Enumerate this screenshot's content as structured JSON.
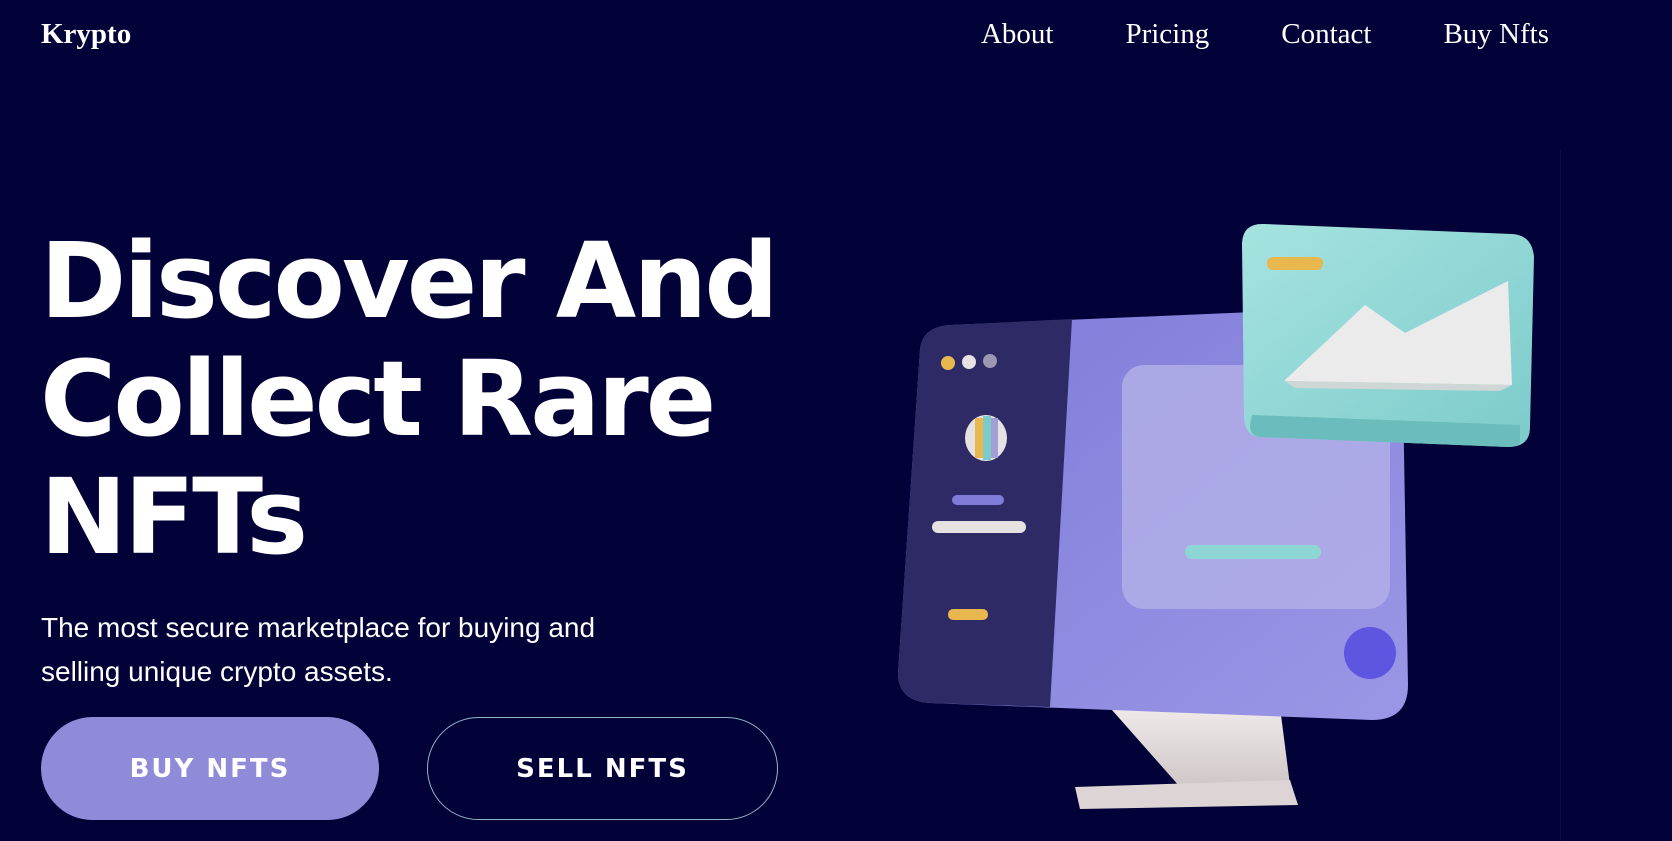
{
  "nav": {
    "logo": "Krypto",
    "links": [
      "About",
      "Pricing",
      "Contact",
      "Buy Nfts"
    ]
  },
  "hero": {
    "title_lines": [
      "Discover And",
      "Collect Rare",
      "NFTs"
    ],
    "subtitle_lines": [
      "The most secure marketplace for buying and",
      "selling unique crypto assets."
    ],
    "primary_button": "BUY NFTS",
    "secondary_button": "SELL NFTS"
  },
  "illustration": {
    "name": "3d-monitor-illustration"
  },
  "colors": {
    "background": "#020138",
    "primary_button": "#8f8bd9",
    "monitor_body": "#8b88e0",
    "monitor_sidebar": "#2e2a66",
    "image_card": "#8ed6d6",
    "stand": "#e2dcdc",
    "dot_yellow": "#e8b84f",
    "accent_blue": "#5e56e0"
  }
}
